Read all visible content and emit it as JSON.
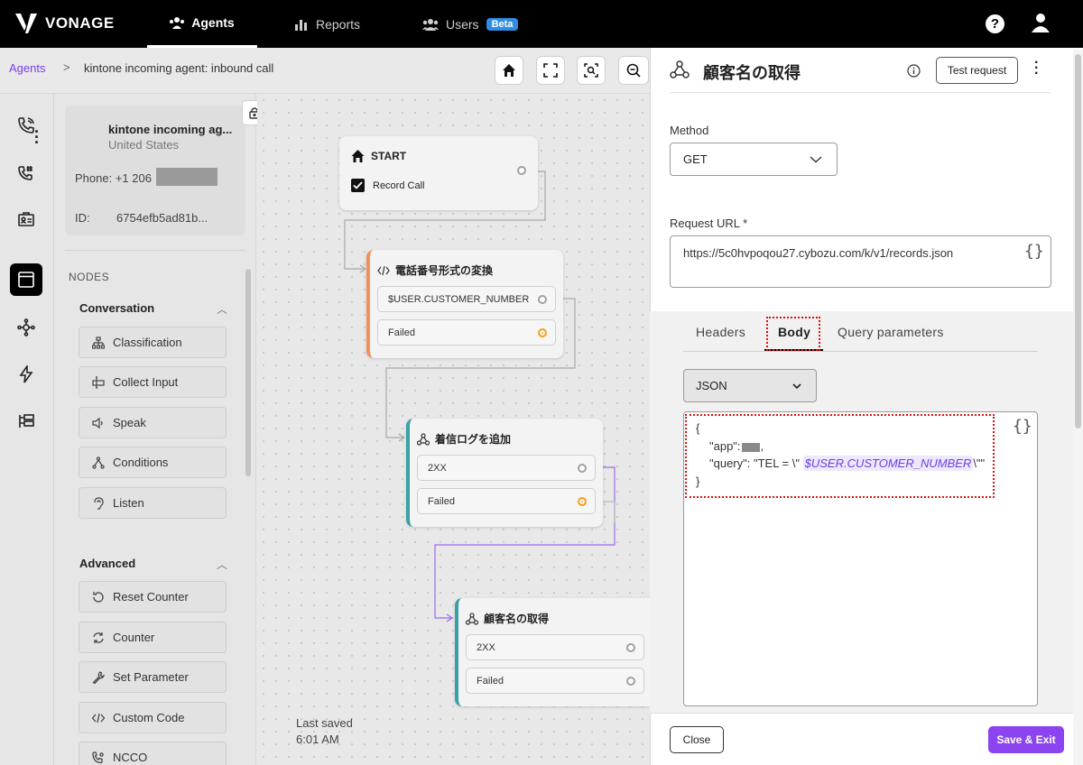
{
  "topbar": {
    "brand": "VONAGE",
    "nav": [
      {
        "label": "Agents"
      },
      {
        "label": "Reports"
      },
      {
        "label": "Users",
        "badge": "Beta"
      }
    ],
    "help": "?"
  },
  "breadcrumb": {
    "root": "Agents",
    "separator": ">",
    "current": "kintone incoming agent: inbound call"
  },
  "agent_card": {
    "name": "kintone incoming ag...",
    "country": "United States",
    "phone_label": "Phone: +1 206",
    "id_label": "ID:",
    "id_value": "6754efb5ad81b..."
  },
  "nodes_panel": {
    "heading": "NODES",
    "groups": [
      {
        "title": "Conversation",
        "items": [
          "Classification",
          "Collect Input",
          "Speak",
          "Conditions",
          "Listen"
        ]
      },
      {
        "title": "Advanced",
        "items": [
          "Reset Counter",
          "Counter",
          "Set Parameter",
          "Custom Code",
          "NCCO"
        ]
      }
    ]
  },
  "canvas": {
    "nodes": [
      {
        "title": "START",
        "checkbox_label": "Record Call"
      },
      {
        "title": "電話番号形式の変換",
        "outputs": [
          "$USER.CUSTOMER_NUMBER",
          "Failed"
        ]
      },
      {
        "title": "着信ログを追加",
        "outputs": [
          "2XX",
          "Failed"
        ]
      },
      {
        "title": "顧客名の取得",
        "outputs": [
          "2XX",
          "Failed"
        ]
      }
    ],
    "last_saved_label": "Last saved",
    "last_saved_time": "6:01 AM"
  },
  "drawer": {
    "title": "顧客名の取得",
    "test_request": "Test request",
    "method_label": "Method",
    "method_value": "GET",
    "url_label": "Request URL *",
    "url_value": "https://5c0hvpoqou27.cybozu.com/k/v1/records.json",
    "braces": "{}",
    "tabs": [
      "Headers",
      "Body",
      "Query parameters"
    ],
    "active_tab": "Body",
    "format_value": "JSON",
    "code": {
      "open": "{",
      "app_key": "\"app\":",
      "app_tail": ",",
      "query_prefix": "\"query\": \"TEL = \\\"",
      "query_var": "$USER.CUSTOMER_NUMBER",
      "query_suffix": "\\\"\"",
      "close": "}"
    },
    "close_button": "Close",
    "save_button": "Save & Exit"
  },
  "colors": {
    "accent": "#8b44f0",
    "link": "#7a3df0",
    "topbar": "#000000",
    "highlight": "#e01010"
  }
}
